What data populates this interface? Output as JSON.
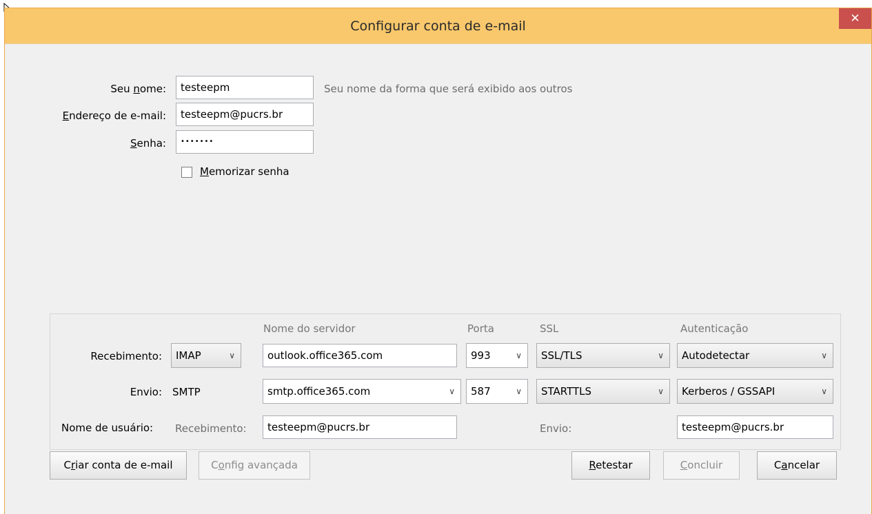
{
  "window": {
    "title": "Configurar conta de e-mail",
    "close_glyph": "✕"
  },
  "identity": {
    "name_label_pre": "Seu ",
    "name_label_key": "n",
    "name_label_post": "ome:",
    "name_value": "testeepm",
    "name_hint": "Seu nome da forma que será exibido aos outros",
    "email_label_key": "E",
    "email_label_post": "ndereço de e-mail:",
    "email_value": "testeepm@pucrs.br",
    "password_label_key": "S",
    "password_label_post": "enha:",
    "password_value": "•••••••",
    "remember_label_key": "M",
    "remember_label_post": "emorizar senha",
    "remember_checked": false
  },
  "server": {
    "headers": {
      "hostname": "Nome do servidor",
      "port": "Porta",
      "ssl": "SSL",
      "auth": "Autenticação"
    },
    "incoming": {
      "label": "Recebimento:",
      "protocol": "IMAP",
      "hostname": "outlook.office365.com",
      "port": "993",
      "ssl": "SSL/TLS",
      "auth": "Autodetectar"
    },
    "outgoing": {
      "label": "Envio:",
      "protocol": "SMTP",
      "hostname": "smtp.office365.com",
      "port": "587",
      "ssl": "STARTTLS",
      "auth": "Kerberos / GSSAPI"
    },
    "username": {
      "label": "Nome de usuário:",
      "incoming_label": "Recebimento:",
      "incoming_value": "testeepm@pucrs.br",
      "outgoing_label": "Envio:",
      "outgoing_value": "testeepm@pucrs.br"
    }
  },
  "buttons": {
    "create_pre": "C",
    "create_key": "r",
    "create_post": "iar conta de e-mail",
    "advanced_pre": "C",
    "advanced_key": "o",
    "advanced_post": "nfig avançada",
    "retest_key": "R",
    "retest_post": "etestar",
    "done_key": "C",
    "done_post": "oncluir",
    "cancel_pre": "C",
    "cancel_key": "a",
    "cancel_post": "ncelar"
  },
  "icons": {
    "close": "close-icon",
    "dropdown": "chevron-down-icon",
    "cursor": "mouse-pointer-icon"
  },
  "colors": {
    "titlebar": "#f9c86c",
    "close": "#c9504d",
    "body": "#f0f0f0"
  }
}
